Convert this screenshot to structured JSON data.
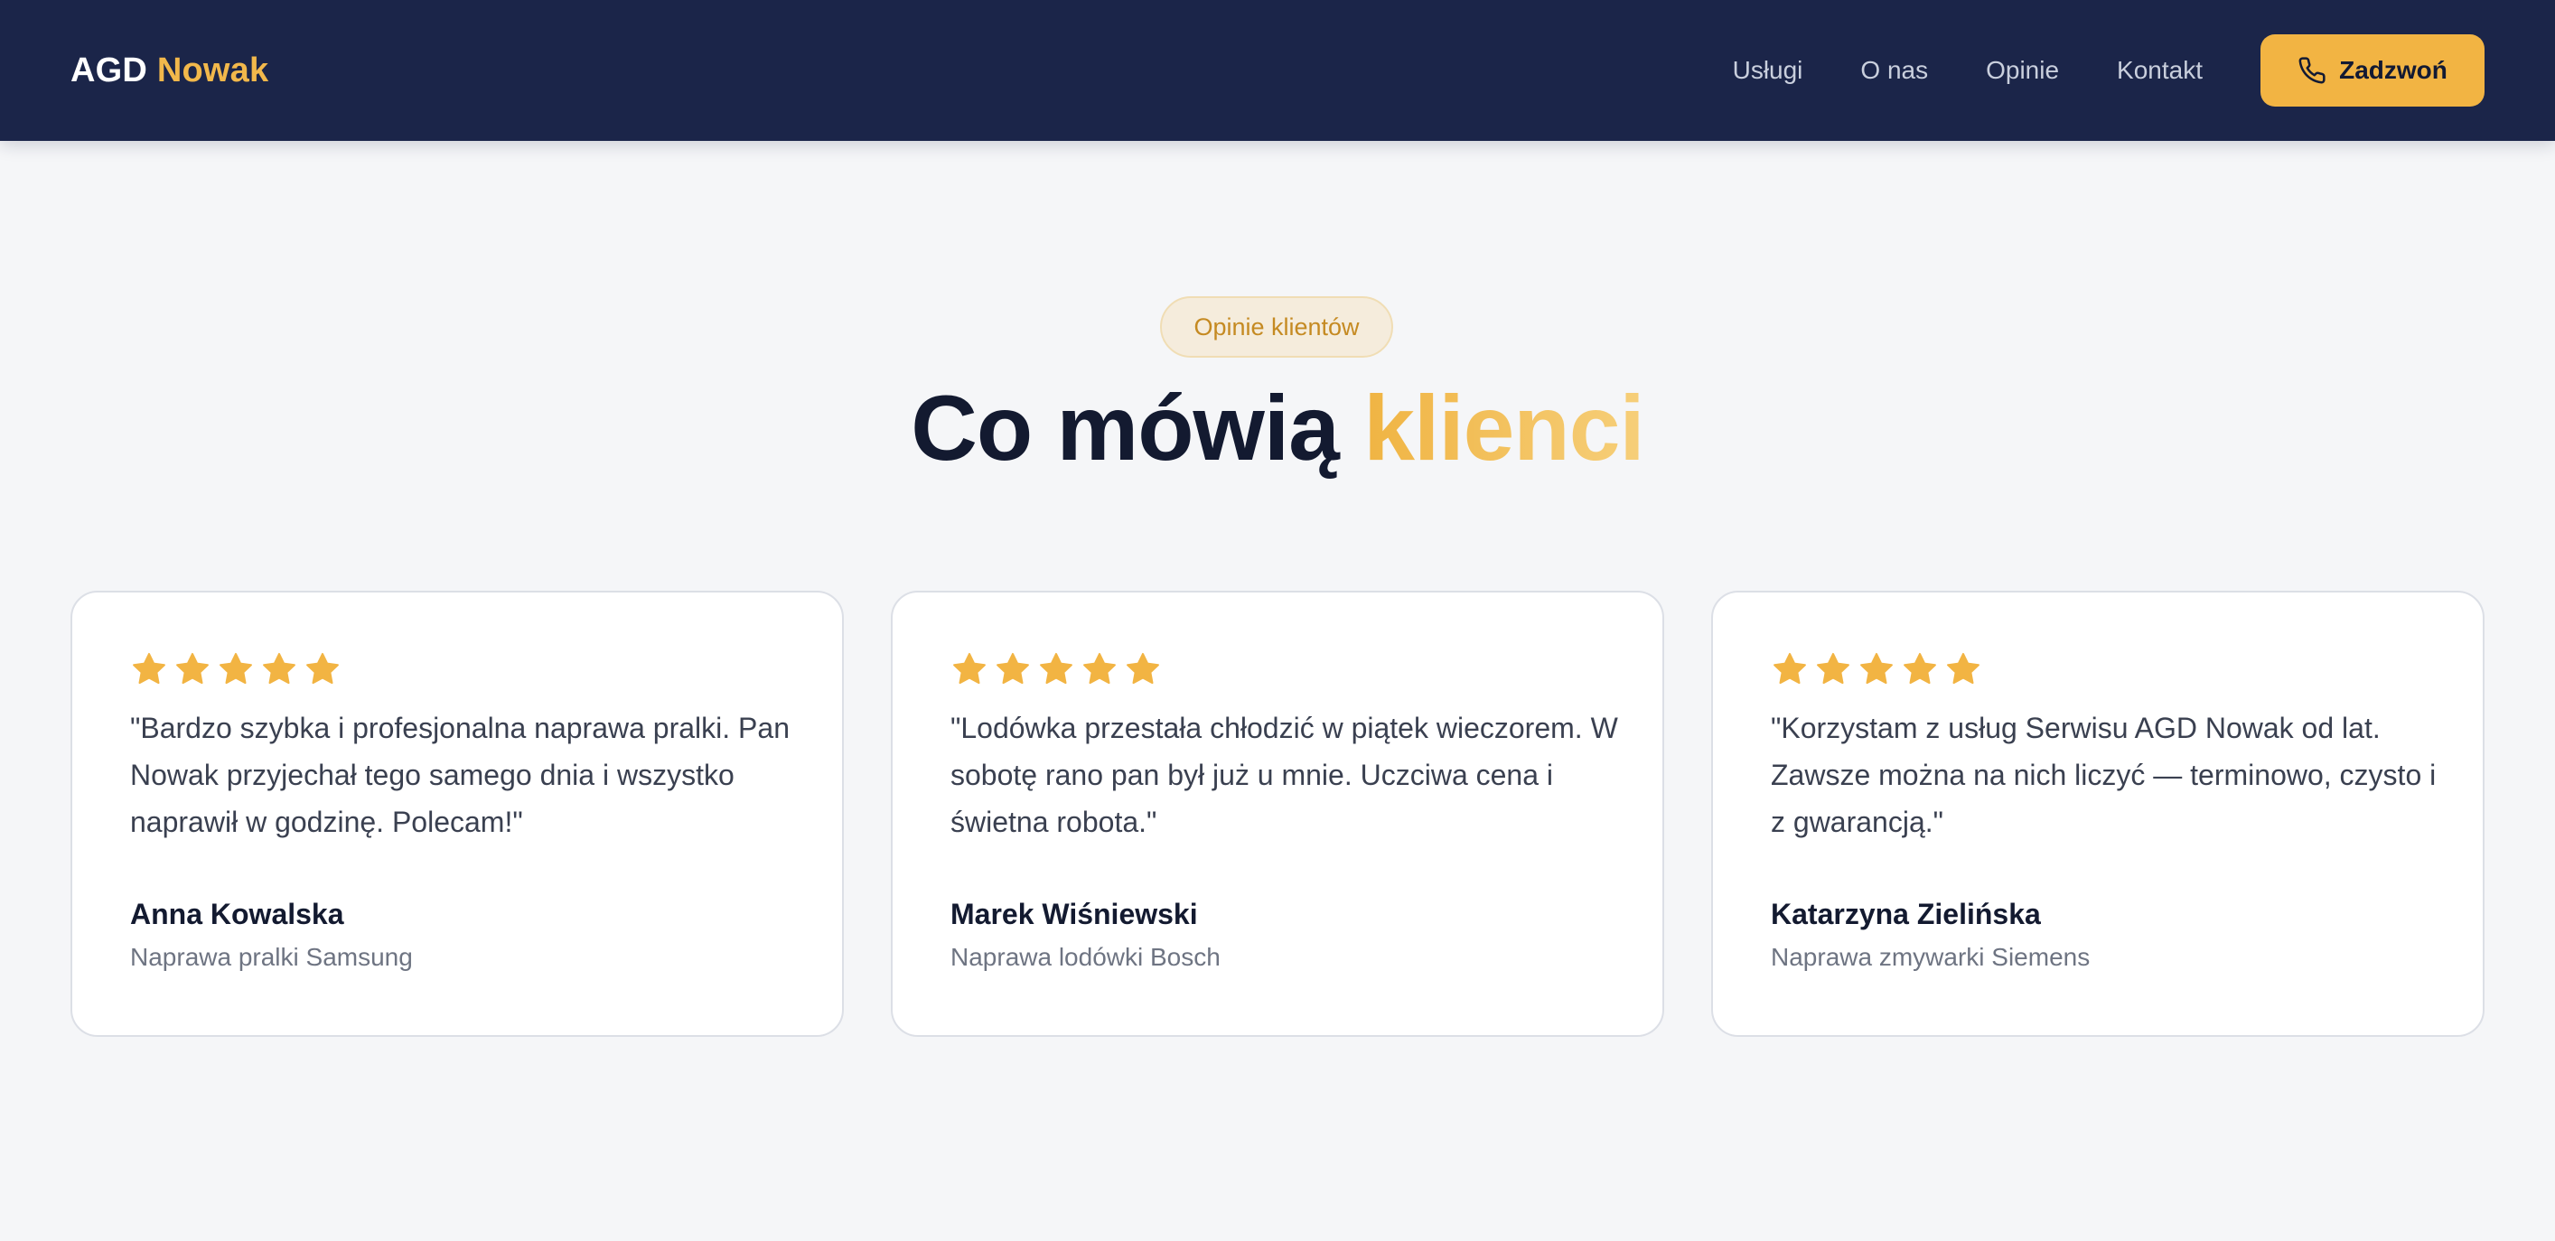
{
  "header": {
    "logo_main": "AGD",
    "logo_accent": "Nowak",
    "nav": [
      "Usługi",
      "O nas",
      "Opinie",
      "Kontakt"
    ],
    "cta_label": "Zadzwoń",
    "cta_icon": "phone-icon"
  },
  "section": {
    "badge": "Opinie klientów",
    "title_main": "Co mówią ",
    "title_accent": "klienci"
  },
  "testimonials": [
    {
      "stars": 5,
      "quote": "\"Bardzo szybka i profesjonalna naprawa pralki. Pan Nowak przyjechał tego samego dnia i wszystko naprawił w godzinę. Polecam!\"",
      "author": "Anna Kowalska",
      "service": "Naprawa pralki Samsung"
    },
    {
      "stars": 5,
      "quote": "\"Lodówka przestała chłodzić w piątek wieczorem. W sobotę rano pan był już u mnie. Uczciwa cena i świetna robota.\"",
      "author": "Marek Wiśniewski",
      "service": "Naprawa lodówki Bosch"
    },
    {
      "stars": 5,
      "quote": "\"Korzystam z usług Serwisu AGD Nowak od lat. Zawsze można na nich liczyć — terminowo, czysto i z gwarancją.\"",
      "author": "Katarzyna Zielińska",
      "service": "Naprawa zmywarki Siemens"
    }
  ],
  "colors": {
    "navbar": "#1b2549",
    "accent": "#f2b443",
    "background": "#f5f6f8",
    "star": "#f2b443"
  }
}
